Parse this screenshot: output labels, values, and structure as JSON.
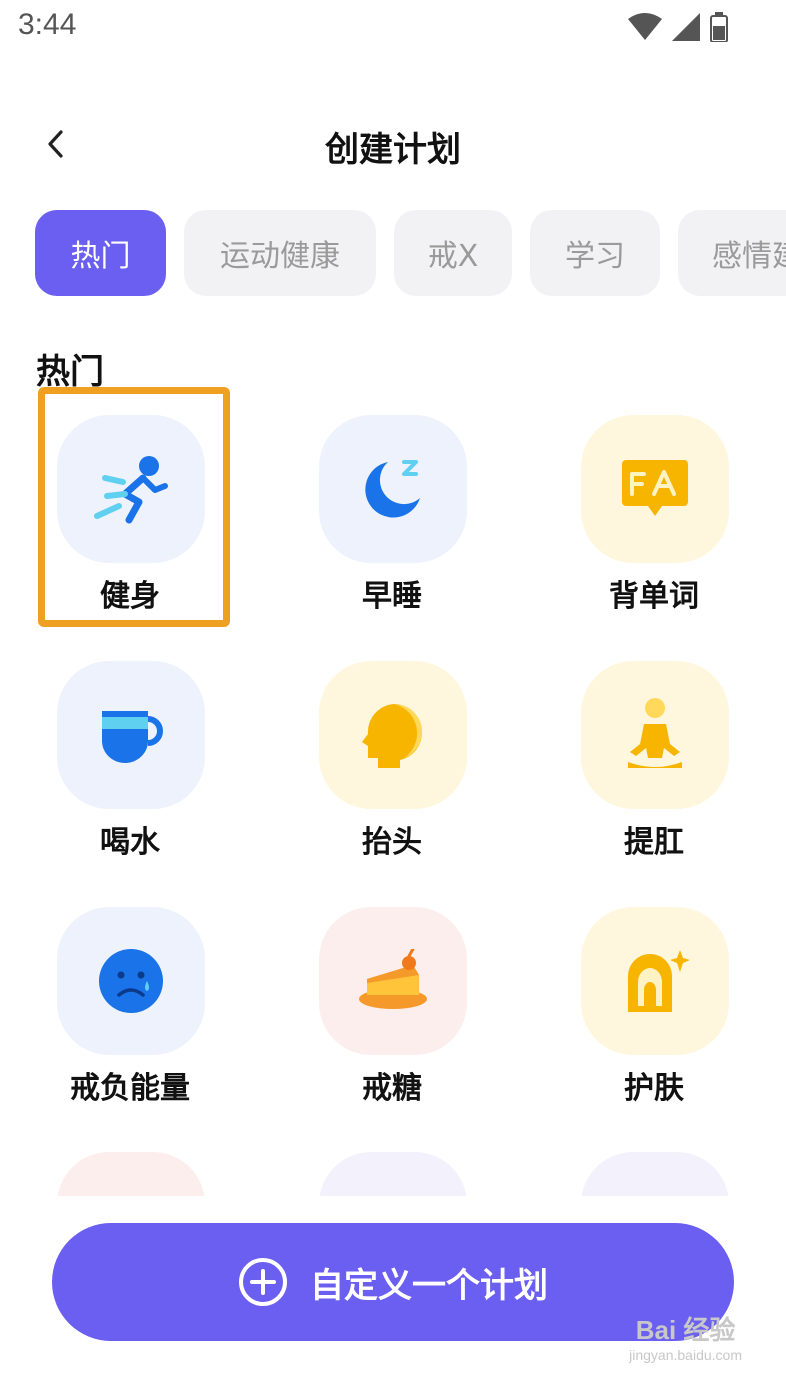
{
  "status_bar": {
    "time": "3:44"
  },
  "header": {
    "title": "创建计划"
  },
  "tabs": [
    {
      "label": "热门",
      "active": true
    },
    {
      "label": "运动健康",
      "active": false
    },
    {
      "label": "戒X",
      "active": false
    },
    {
      "label": "学习",
      "active": false
    },
    {
      "label": "感情建",
      "active": false
    }
  ],
  "section": {
    "title": "热门"
  },
  "items": [
    {
      "label": "健身",
      "icon": "running-person-icon",
      "tile": "blue"
    },
    {
      "label": "早睡",
      "icon": "moon-sleep-icon",
      "tile": "blue"
    },
    {
      "label": "背单词",
      "icon": "vocabulary-icon",
      "tile": "yellow"
    },
    {
      "label": "喝水",
      "icon": "cup-icon",
      "tile": "blue"
    },
    {
      "label": "抬头",
      "icon": "head-icon",
      "tile": "yellow"
    },
    {
      "label": "提肛",
      "icon": "meditation-icon",
      "tile": "yellow"
    },
    {
      "label": "戒负能量",
      "icon": "sad-face-icon",
      "tile": "blue"
    },
    {
      "label": "戒糖",
      "icon": "cake-icon",
      "tile": "pink"
    },
    {
      "label": "护肤",
      "icon": "skincare-icon",
      "tile": "yellow"
    }
  ],
  "bottom_button": {
    "label": "自定义一个计划",
    "icon": "plus-circle-icon"
  },
  "watermark": {
    "text": "Bai 经验",
    "sub": "jingyan.baidu.com"
  },
  "colors": {
    "accent": "#6a5ff0",
    "highlight": "#f0a020",
    "blue_icon": "#1a73e8",
    "yellow_icon": "#f7b500"
  }
}
